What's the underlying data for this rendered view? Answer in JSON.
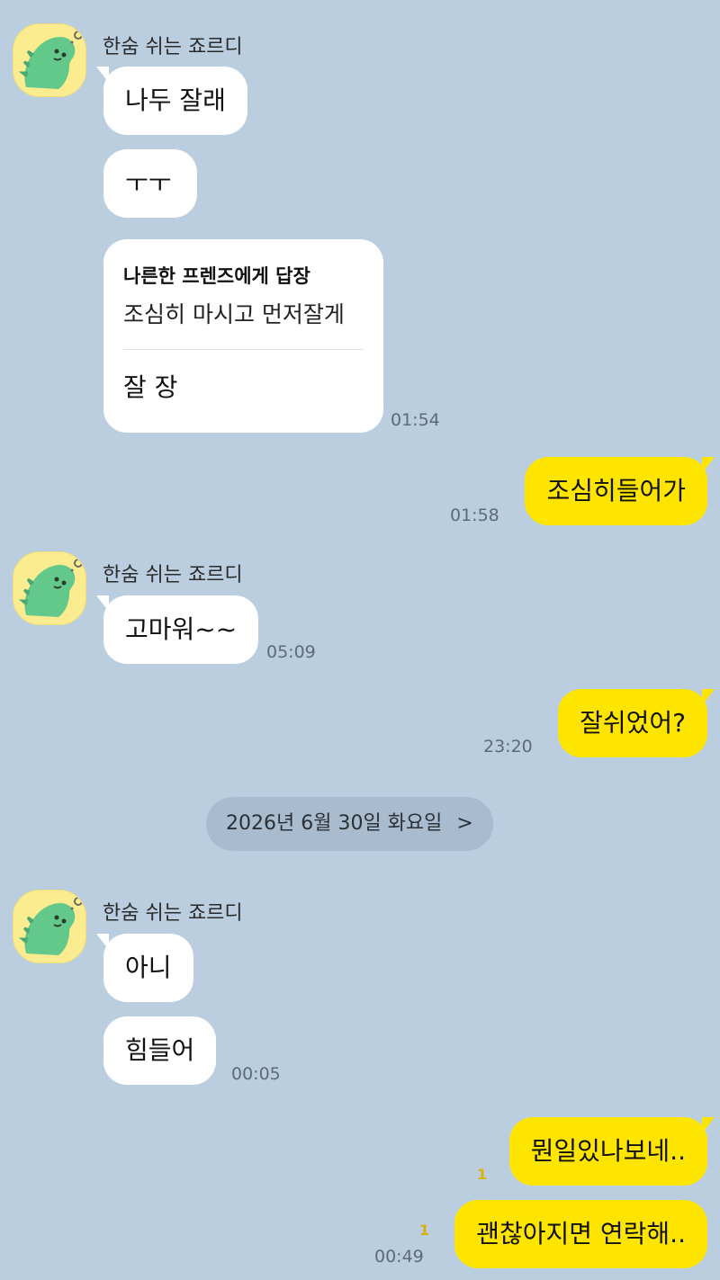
{
  "sender_name": "한숨 쉬는 죠르디",
  "date_divider": {
    "label": "2026년 6월 30일 화요일",
    "chevron": ">"
  },
  "messages": [
    {
      "text": "나두 잘래"
    },
    {
      "text": "ㅜㅜ"
    },
    {
      "reply_title": "나른한 프렌즈에게 답장",
      "reply_quote": "조심히 마시고 먼저잘게",
      "text": "잘 장",
      "time": "01:54"
    },
    {
      "text": "조심히들어가",
      "time": "01:58"
    },
    {
      "text": "고마워~~",
      "time": "05:09"
    },
    {
      "text": "잘쉬었어?",
      "time": "23:20"
    },
    {
      "text": "아니"
    },
    {
      "text": "힘들어",
      "time": "00:05"
    },
    {
      "text": "뭔일있나보네..",
      "unread": "1"
    },
    {
      "text": "괜찮아지면 연락해..",
      "unread": "1",
      "time": "00:49"
    }
  ],
  "icons": {
    "avatar": "jordy-dinosaur-avatar-icon",
    "chevron": "chevron-right-icon"
  },
  "colors": {
    "background": "#bacee0",
    "my_bubble": "#fee500",
    "their_bubble": "#ffffff",
    "avatar_bg": "#fbec8f"
  }
}
